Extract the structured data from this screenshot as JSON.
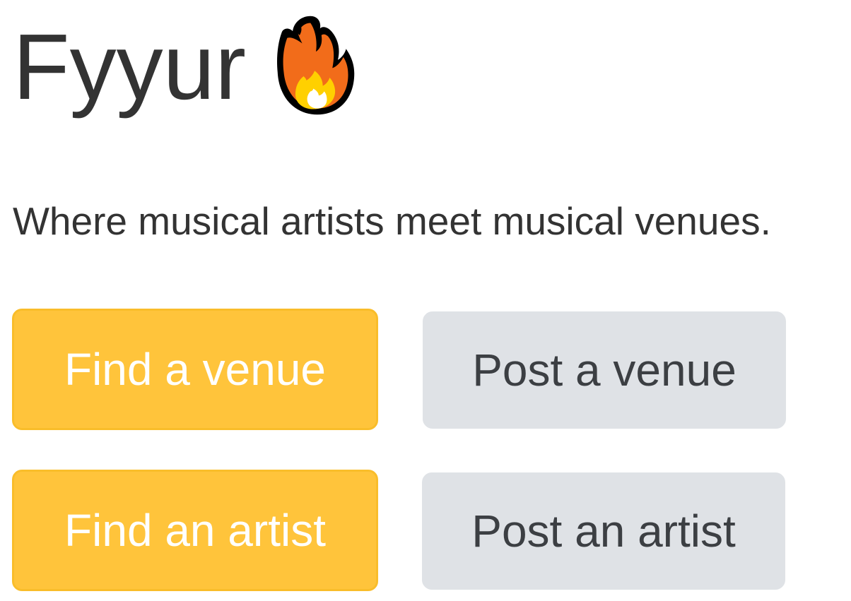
{
  "header": {
    "title": "Fyyur",
    "icon": "fire-icon"
  },
  "tagline": "Where musical artists meet musical venues.",
  "buttons": {
    "find_venue": "Find a venue",
    "post_venue": "Post a venue",
    "find_artist": "Find an artist",
    "post_artist": "Post an artist"
  },
  "colors": {
    "primary_button": "#ffc43b",
    "secondary_button": "#dfe2e6",
    "text": "#333333",
    "flame_outer": "#f26c1a",
    "flame_inner": "#ffd000"
  }
}
